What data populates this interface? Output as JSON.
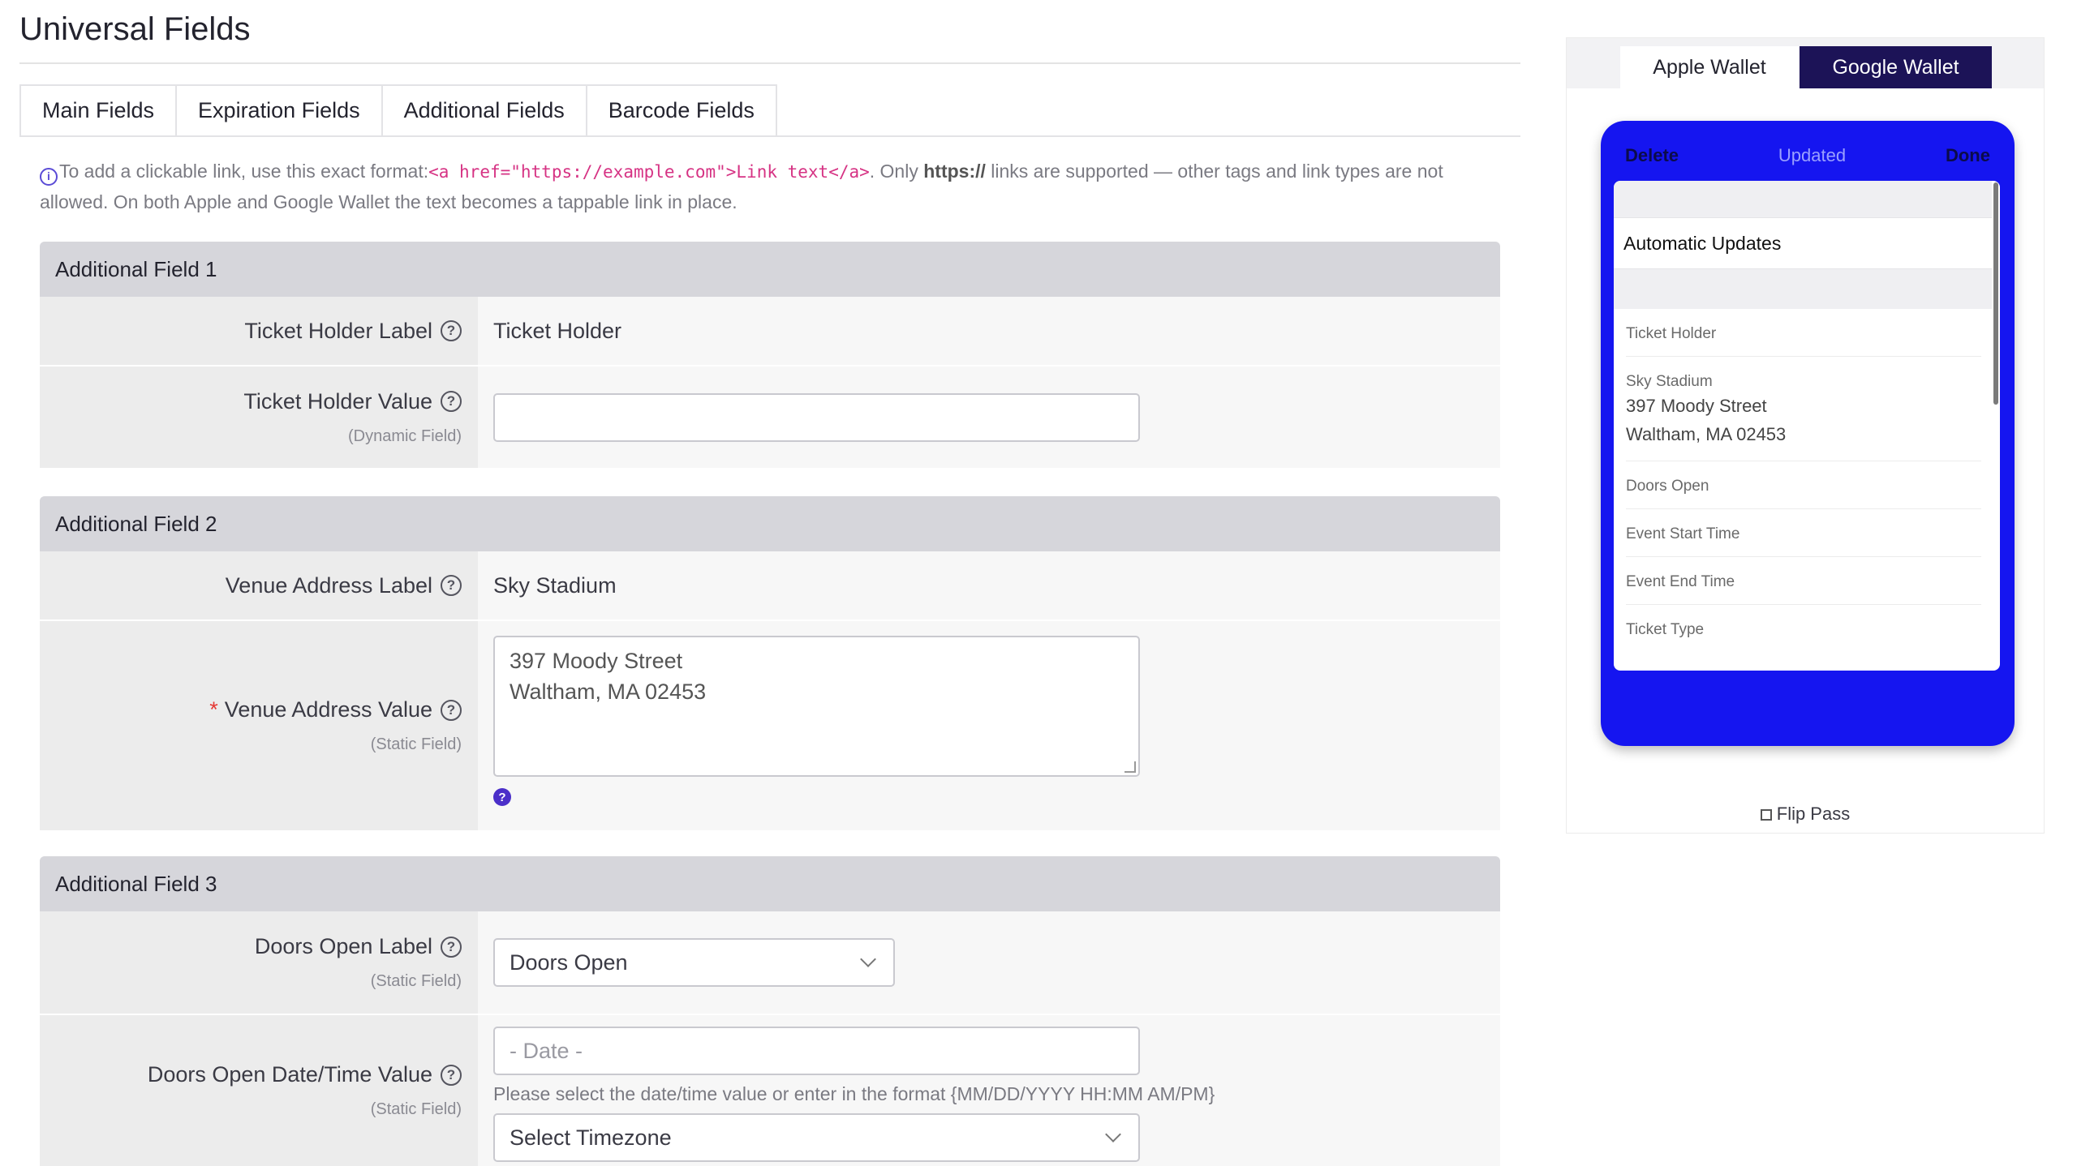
{
  "page": {
    "title": "Universal Fields"
  },
  "tabs": [
    {
      "label": "Main Fields"
    },
    {
      "label": "Expiration Fields"
    },
    {
      "label": "Additional Fields",
      "active": true
    },
    {
      "label": "Barcode Fields"
    }
  ],
  "notice": {
    "lead": "To add a clickable link, use this exact format:",
    "code": "<a href=\"https://example.com\">Link text</a>",
    "mid": ". Only ",
    "bold": "https://",
    "tail": " links are supported — other tags and link types are not allowed. On both Apple and Google Wallet the text becomes a tappable link in place."
  },
  "field1": {
    "header": "Additional Field 1",
    "label_label": "Ticket Holder Label",
    "label_value": "Ticket Holder",
    "value_label": "Ticket Holder Value",
    "value_sub": "(Dynamic Field)",
    "value_input": ""
  },
  "field2": {
    "header": "Additional Field 2",
    "label_label": "Venue Address Label",
    "label_value": "Sky Stadium",
    "required_mark": "*",
    "value_label": "Venue Address Value",
    "value_sub": "(Static Field)",
    "value_line1": "397 Moody Street",
    "value_line2": "Waltham, MA 02453"
  },
  "field3": {
    "header": "Additional Field 3",
    "label_label": "Doors Open Label",
    "label_sub": "(Static Field)",
    "label_select": "Doors Open",
    "value_label": "Doors Open Date/Time Value",
    "value_sub": "(Static Field)",
    "date_placeholder": "- Date -",
    "hint": "Please select the date/time value or enter in the format {MM/DD/YYYY HH:MM AM/PM}",
    "timezone_select": "Select Timezone"
  },
  "wallet_tabs": {
    "apple": "Apple Wallet",
    "google": "Google Wallet"
  },
  "phone": {
    "delete": "Delete",
    "status": "Updated",
    "done": "Done",
    "sheet_title": "Automatic Updates",
    "items": [
      {
        "k": "Ticket Holder",
        "v1": "",
        "v2": ""
      },
      {
        "k": "Sky Stadium",
        "v1": "397 Moody Street",
        "v2": "Waltham, MA 02453"
      },
      {
        "k": "Doors Open",
        "v1": "",
        "v2": ""
      },
      {
        "k": "Event Start Time",
        "v1": "",
        "v2": ""
      },
      {
        "k": "Event End Time",
        "v1": "",
        "v2": ""
      },
      {
        "k": "Ticket Type",
        "v1": "",
        "v2": ""
      }
    ],
    "color": "#1515f0"
  },
  "flip_label": "Flip Pass",
  "icons": {
    "help": "question-circle-icon",
    "info": "info-circle-icon",
    "chevron": "chevron-down-icon",
    "flip": "flip-icon"
  }
}
